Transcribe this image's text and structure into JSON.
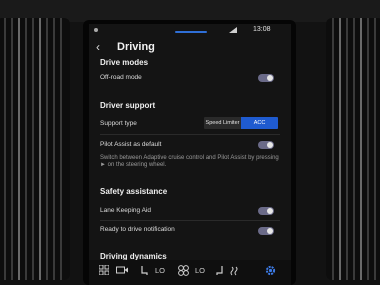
{
  "status_bar": {
    "time": "13:08"
  },
  "header": {
    "title": "Driving"
  },
  "sections": {
    "drive_modes": {
      "title": "Drive modes",
      "off_road_label": "Off-road mode"
    },
    "driver_support": {
      "title": "Driver support",
      "support_type_label": "Support type",
      "options": [
        "Speed Limiter",
        "ACC"
      ],
      "selected_option": "ACC",
      "pilot_assist_label": "Pilot Assist as default",
      "pilot_assist_desc": "Switch between Adaptive cruise control and Pilot Assist by pressing ► on the steering wheel."
    },
    "safety_assistance": {
      "title": "Safety assistance",
      "lane_keeping_label": "Lane Keeping Aid",
      "ready_to_drive_label": "Ready to drive notification"
    },
    "driving_dynamics": {
      "title": "Driving dynamics"
    }
  },
  "bottom_bar": {
    "left_temp": "LO",
    "right_temp": "LO",
    "icons": [
      "apps-grid-icon",
      "camera-icon",
      "seat-heat-icon",
      "fan-icon",
      "seat-heat-icon",
      "heated-seat-right-icon",
      "settings-icon"
    ]
  },
  "colors": {
    "accent": "#1f5bd0",
    "toggle_off": "#6a6a88",
    "settings_icon": "#3d7be6"
  }
}
